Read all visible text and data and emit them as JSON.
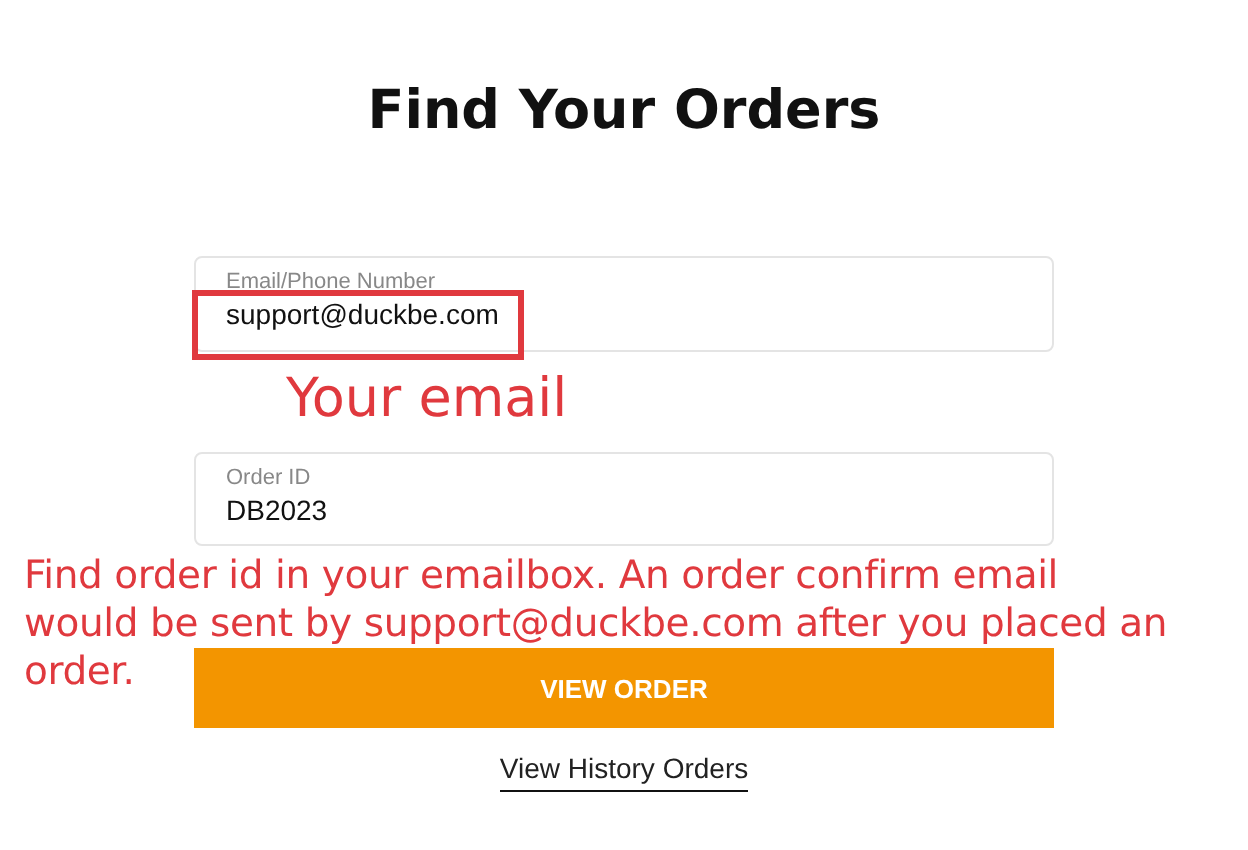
{
  "title": "Find Your Orders",
  "fields": [
    {
      "label": "Email/Phone Number",
      "value": "support@duckbe.com"
    },
    {
      "label": "Order ID",
      "value": "DB2023"
    }
  ],
  "submit_button": "VIEW ORDER",
  "history_link": "View History Orders",
  "annotations": [
    {
      "kind": "box"
    },
    {
      "kind": "note",
      "text": "Your email"
    },
    {
      "kind": "lines",
      "lines": [
        "Find order id in your emailbox. An order confirm email",
        "would be sent by support@duckbe.com after you placed an",
        "order."
      ]
    }
  ]
}
